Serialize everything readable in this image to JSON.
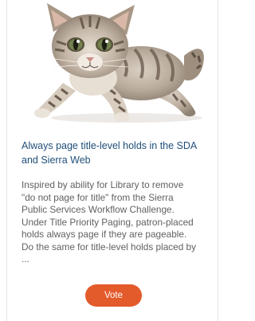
{
  "card": {
    "image_subject": "kitten photo",
    "title": "Always page title-level holds in the SDA and Sierra Web",
    "description": "Inspired by ability for Library to remove\n\"do not page for title\" from the Sierra\nPublic Services Workflow Challenge.\nUnder Title Priority Paging, patron-placed\nholds always page if they are pageable.\nDo the same for title-level holds placed by\n...",
    "vote_label": "Vote"
  },
  "colors": {
    "title": "#1f4e79",
    "description": "#616161",
    "vote_button": "#e35a2b"
  }
}
